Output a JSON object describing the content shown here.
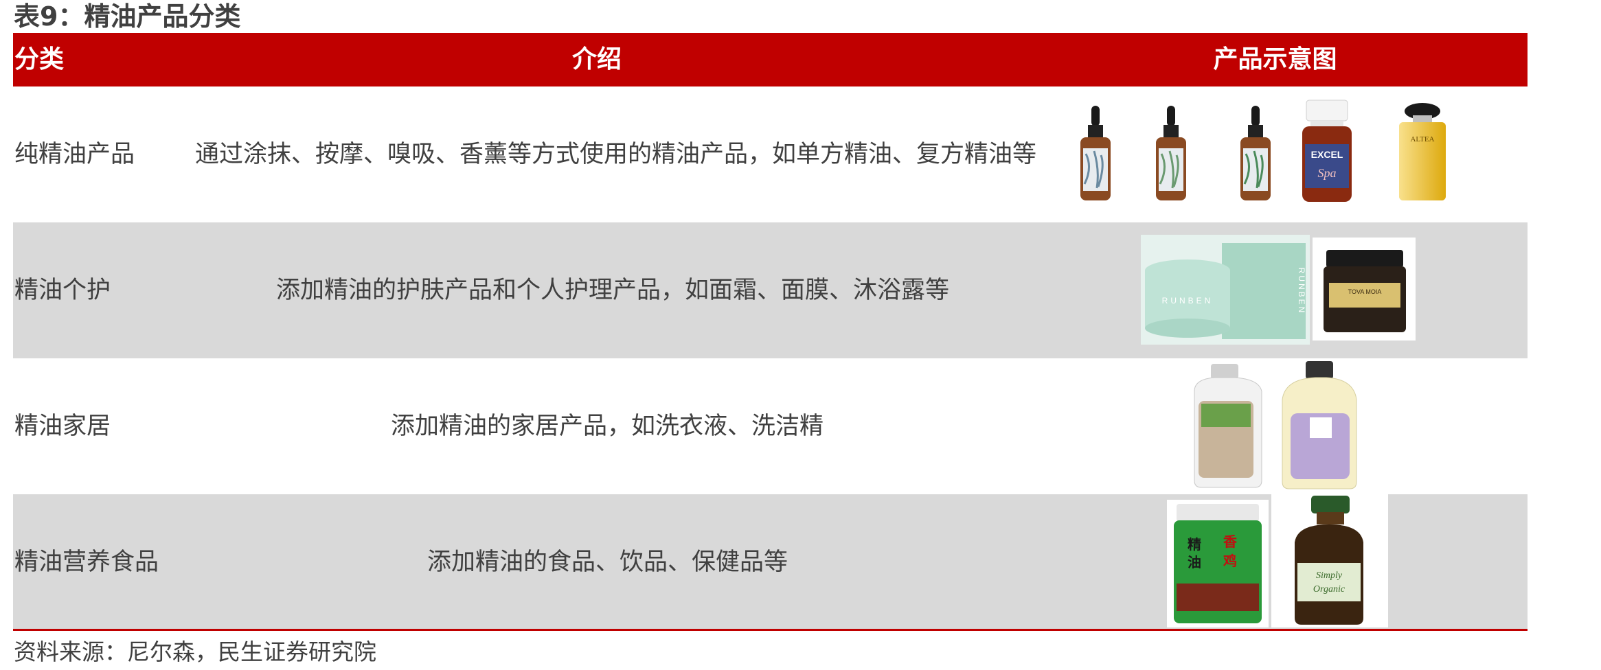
{
  "title": "表9：精油产品分类",
  "header": {
    "category": "分类",
    "intro": "介绍",
    "image": "产品示意图"
  },
  "rows": [
    {
      "category": "纯精油产品",
      "intro": "通过涂抹、按摩、嗅吸、香薰等方式使用的精油产品，如单方精油、复方精油等",
      "products": [
        "dropper-bottle-1",
        "dropper-bottle-2",
        "dropper-bottle-3",
        "excel-spa-bottle",
        "yellow-oil-bottle"
      ],
      "label_text": [
        "EXCEL",
        "Spa",
        "ALTEA"
      ]
    },
    {
      "category": "精油个护",
      "intro": "添加精油的护肤产品和个人护理产品，如面霜、面膜、沐浴露等",
      "products": [
        "runben-cream-jar-box",
        "dark-cream-jar"
      ],
      "label_text": [
        "RUNBEN",
        "RUNBEN",
        "TOVA MOIA"
      ]
    },
    {
      "category": "精油家居",
      "intro": "添加精油的家居产品，如洗衣液、洗洁精",
      "products": [
        "laundry-bottle-green",
        "laundry-bottle-lavender"
      ]
    },
    {
      "category": "精油营养食品",
      "intro": "添加精油的食品、饮品、保健品等",
      "products": [
        "chicken-essence-jar",
        "simply-organic-bottle"
      ],
      "label_text": [
        "精",
        "油",
        "香",
        "鸡",
        "Simply",
        "Organic"
      ]
    }
  ],
  "source": "资料来源：尼尔森，民生证券研究院",
  "colors": {
    "header_bg": "#c00000",
    "alt_row_bg": "#d9d9d9",
    "text": "#404040"
  }
}
